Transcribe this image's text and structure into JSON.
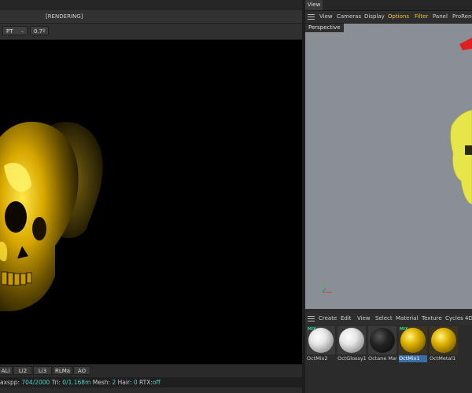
{
  "render_panel": {
    "status": "[RENDERING]",
    "toolbar": {
      "kernel": "PT",
      "value": "0.7"
    },
    "passes": [
      "ALi",
      "Li2",
      "Li3",
      "RLMa",
      "AO"
    ],
    "stats": {
      "maxspp_label": "axspp:",
      "maxspp_value": "704/2000",
      "tri_label": "Tri:",
      "tri_value": "0/1.168m",
      "mesh_label": "Mesh:",
      "mesh_value": "2",
      "hair_label": "Hair:",
      "hair_value": "0",
      "rtx_label": "RTX:",
      "rtx_value": "off"
    }
  },
  "view_panel": {
    "tab": "View",
    "menu": [
      "View",
      "Cameras",
      "Display",
      "Options",
      "Filter",
      "Panel",
      "ProRende"
    ],
    "highlighted_menu": [
      "Options",
      "Filter"
    ],
    "viewport_label": "Perspective"
  },
  "material_manager": {
    "menu": [
      "Create",
      "Edit",
      "View",
      "Select",
      "Material",
      "Texture",
      "Cycles 4D"
    ],
    "materials": [
      {
        "name": "OctMix2",
        "kind": "white",
        "tag": "MIX",
        "selected": false
      },
      {
        "name": "OctGlossy1",
        "kind": "white",
        "tag": "",
        "selected": false
      },
      {
        "name": "Octane Mat",
        "kind": "black",
        "tag": "",
        "selected": false
      },
      {
        "name": "OctMix1",
        "kind": "gold",
        "tag": "MIX",
        "selected": true
      },
      {
        "name": "OctMetal1",
        "kind": "gold",
        "tag": "",
        "selected": false
      }
    ]
  },
  "colors": {
    "accent_menu": "#f1c232",
    "stat_value": "#4fd1c5",
    "skull_gold": "#e0b400",
    "viewport_bg": "#8a8f95"
  }
}
